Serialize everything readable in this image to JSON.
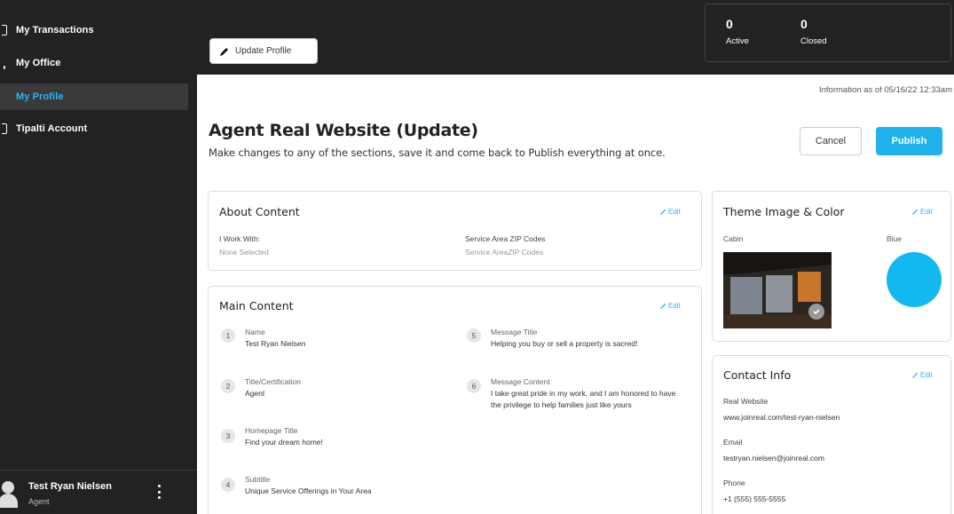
{
  "sidebar": {
    "items": [
      {
        "label": "My Transactions"
      },
      {
        "label": "My Office"
      },
      {
        "label": "My Profile"
      },
      {
        "label": "Tipalti Account"
      }
    ],
    "user": {
      "name": "Test Ryan Nielsen",
      "role": "Agent"
    }
  },
  "topbar": {
    "update_profile_label": "Update Profile",
    "stats": [
      {
        "value": "0",
        "label": "Active"
      },
      {
        "value": "0",
        "label": "Closed"
      }
    ]
  },
  "main": {
    "info_date": "Information as of 05/16/22 12:33am",
    "title": "Agent Real Website (Update)",
    "subtitle": "Make changes to any of the sections, save it and come back to Publish everything at once.",
    "cancel_label": "Cancel",
    "publish_label": "Publish",
    "edit_label": "Edit",
    "about": {
      "title": "About Content",
      "work_with_label": "I Work With:",
      "work_with_value": "None Selected",
      "zip_label": "Service Area ZIP Codes",
      "zip_value": "Service AreaZIP Codes"
    },
    "main_content": {
      "title": "Main Content",
      "items": [
        {
          "num": "1",
          "label": "Name",
          "value": "Test Ryan Nielsen"
        },
        {
          "num": "2",
          "label": "Title/Certification",
          "value": "Agent"
        },
        {
          "num": "3",
          "label": "Homepage Title",
          "value": "Find your dream home!"
        },
        {
          "num": "4",
          "label": "Subtitle",
          "value": "Unique Service Offerings in Your Area"
        },
        {
          "num": "5",
          "label": "Message Title",
          "value": "Helping you buy or sell a property is sacred!"
        },
        {
          "num": "6",
          "label": "Message Content",
          "value": "I take great pride in my work, and I am honored to have the privilege to help families just like yours"
        }
      ]
    },
    "theme": {
      "title": "Theme Image & Color",
      "image_label": "Cabin",
      "color_label": "Blue",
      "color_hex": "#12b8f0"
    },
    "contact": {
      "title": "Contact Info",
      "website_label": "Real Website",
      "website_value": "www.joinreal.com/test-ryan-nielsen",
      "email_label": "Email",
      "email_value": "testryan.nielsen@joinreal.com",
      "phone_label": "Phone",
      "phone_value": "+1 (555) 555-5555"
    }
  },
  "colors": {
    "accent": "#1fb3ee",
    "sidebar_bg": "#222222",
    "active_nav": "#2ab6f4"
  }
}
